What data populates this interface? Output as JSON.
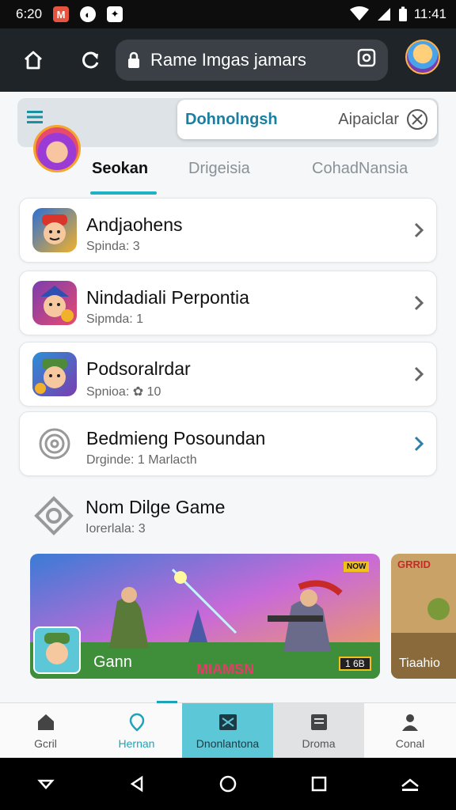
{
  "status_bar": {
    "time": "6:20",
    "clock": "11:41"
  },
  "browser": {
    "url": "Rame Imgas jamars"
  },
  "header": {
    "search_value": "Dohnolngsh",
    "search_right": "Aipaiclar"
  },
  "tabs": [
    {
      "label": "Seokan",
      "active": true
    },
    {
      "label": "Drigeisia",
      "active": false
    },
    {
      "label": "CohadNansia",
      "active": false
    }
  ],
  "list": [
    {
      "title": "Andjaohens",
      "subtitle": "Spinda: 3"
    },
    {
      "title": "Nindadiali Perpontia",
      "subtitle": "Sipmda: 1"
    },
    {
      "title": "Podsoralrdar",
      "subtitle": "Spnioa: ✿ 10"
    },
    {
      "title": "Bedmieng Posoundan",
      "subtitle": "Drginde: 1   Marlacth"
    }
  ],
  "plain_item": {
    "title": "Nom Dilge Game",
    "subtitle": "Iorerlala: 3"
  },
  "banner": {
    "caption": "Gann",
    "title": "MIAMSN",
    "badge_top": "NOW",
    "badge_bottom": "1 6B"
  },
  "banner2": {
    "top": "GRRID",
    "caption": "Tiaahio"
  },
  "bottom_nav": [
    {
      "label": "Gcril",
      "icon": "home-icon"
    },
    {
      "label": "Hernan",
      "icon": "location-icon"
    },
    {
      "label": "Dnonlantona",
      "icon": "news-icon"
    },
    {
      "label": "Droma",
      "icon": "document-icon"
    },
    {
      "label": "Conal",
      "icon": "person-icon"
    }
  ],
  "colors": {
    "accent": "#1fb1c6",
    "dark_bar": "#1f2428",
    "highlight": "#5cc7d6"
  }
}
